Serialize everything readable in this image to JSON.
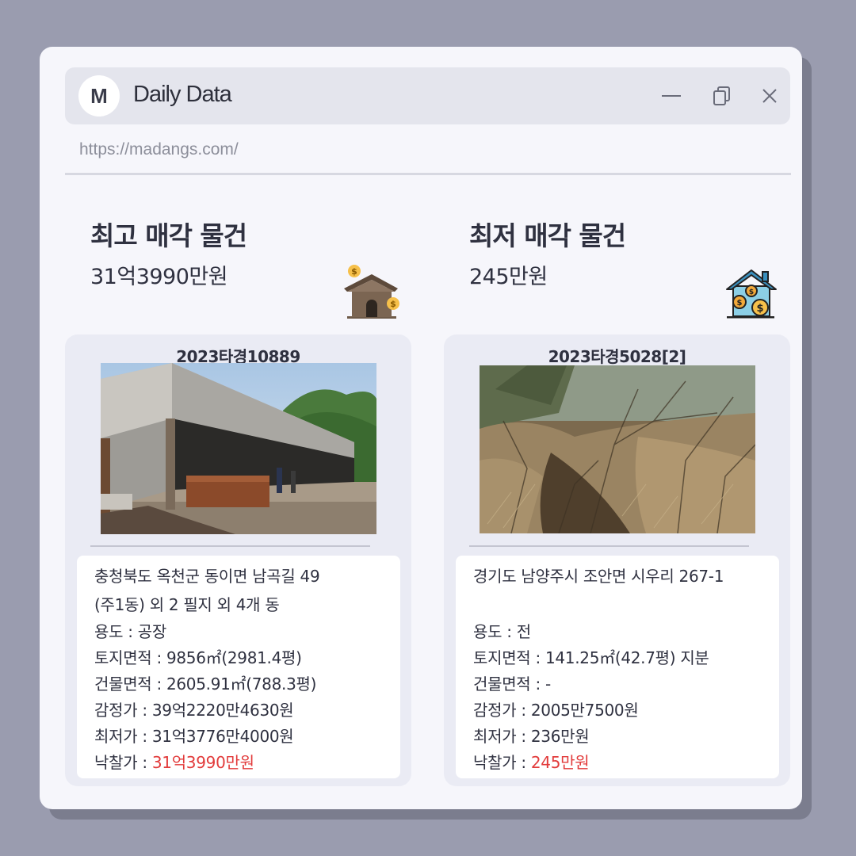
{
  "window": {
    "logo_letter": "M",
    "app_title": "Daily Data",
    "url": "https://madangs.com/",
    "controls": {
      "minimize": "minimize-icon",
      "copy": "copy-icon",
      "close": "close-icon"
    }
  },
  "highest": {
    "title": "최고 매각 물건",
    "price": "31억3990만원",
    "icon": "house-money-icon",
    "card": {
      "case_no": "2023타경10889",
      "address_1": "충청북도 옥천군 동이면 남곡길 49",
      "address_2": "(주1동) 외 2 필지 외 4개 동",
      "usage": "용도 : 공장",
      "land_area": "토지면적 : 9856㎡(2981.4평)",
      "building_area": "건물면적 : 2605.91㎡(788.3평)",
      "appraisal": "감정가 : 39억2220만4630원",
      "minimum": "최저가 : 31억3776만4000원",
      "winning_label": "낙찰가 : ",
      "winning_value": "31억3990만원"
    }
  },
  "lowest": {
    "title": "최저 매각 물건",
    "price": "245만원",
    "icon": "house-coins-icon",
    "card": {
      "case_no": "2023타경5028[2]",
      "address_1": "경기도 남양주시 조안면 시우리 267-1",
      "address_2": "",
      "usage": "용도 :  전",
      "land_area": "토지면적 : 141.25㎡(42.7평) 지분",
      "building_area": "건물면적 : -",
      "appraisal": "감정가 : 2005만7500원",
      "minimum": "최저가 : 236만원",
      "winning_label": "낙찰가 : ",
      "winning_value": "245만원"
    }
  },
  "colors": {
    "accent_red": "#e23b3b",
    "background": "#9a9caf",
    "window": "#f6f6fb"
  }
}
